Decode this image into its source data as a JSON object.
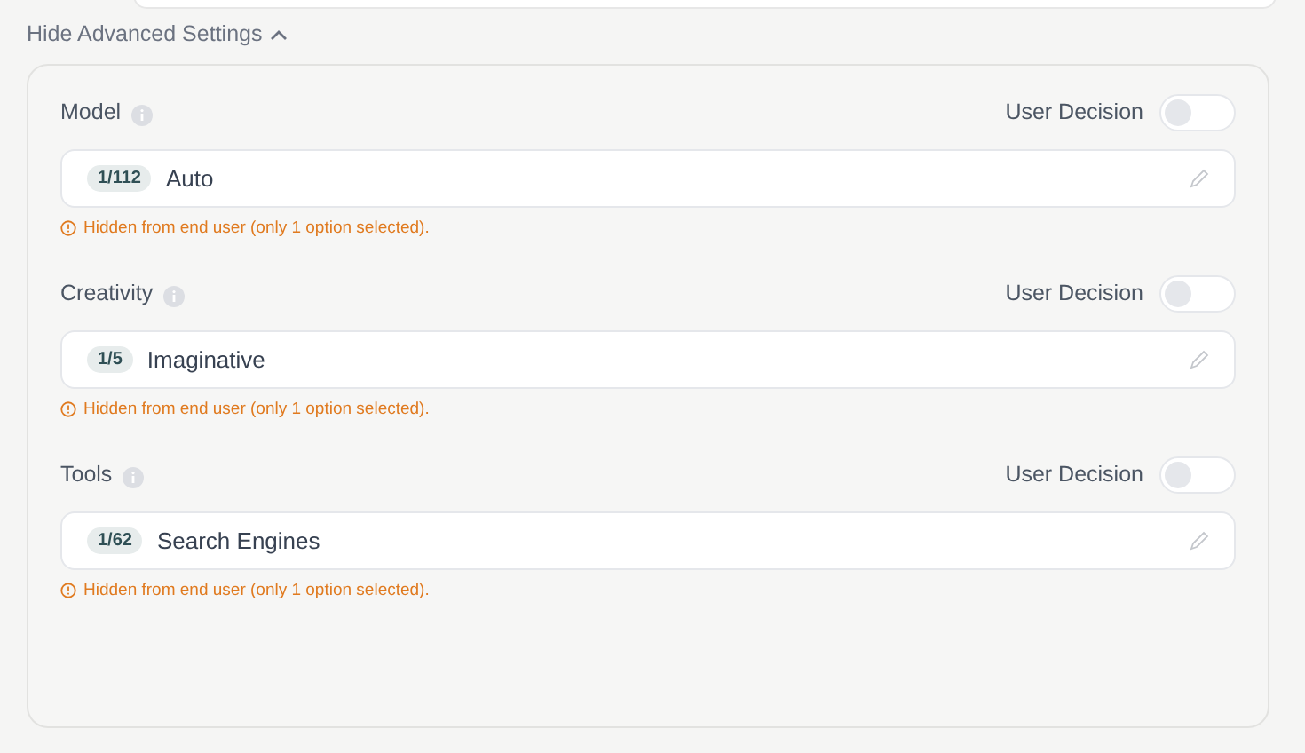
{
  "advanced_toggle": {
    "label": "Hide Advanced Settings",
    "expanded": true
  },
  "settings": [
    {
      "label": "Model",
      "toggle_label": "User Decision",
      "on": false,
      "count": "1/112",
      "value": "Auto",
      "warning": "Hidden from end user (only 1 option selected)."
    },
    {
      "label": "Creativity",
      "toggle_label": "User Decision",
      "on": false,
      "count": "1/5",
      "value": "Imaginative",
      "warning": "Hidden from end user (only 1 option selected)."
    },
    {
      "label": "Tools",
      "toggle_label": "User Decision",
      "on": false,
      "count": "1/62",
      "value": "Search Engines",
      "warning": "Hidden from end user (only 1 option selected)."
    }
  ]
}
